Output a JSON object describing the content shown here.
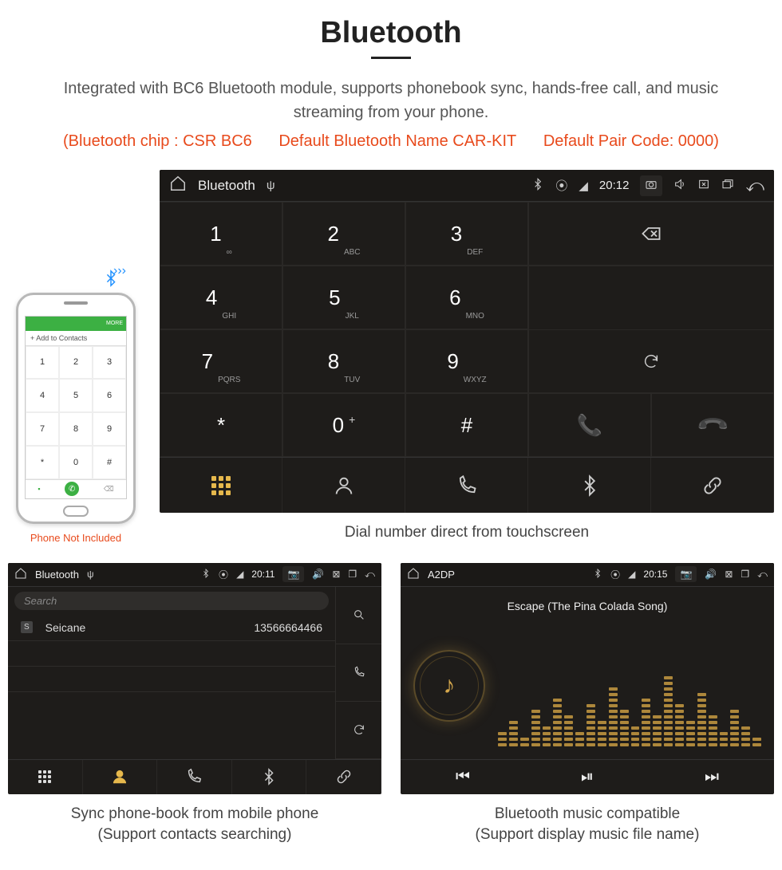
{
  "header": {
    "title": "Bluetooth",
    "subtitle": "Integrated with BC6 Bluetooth module, supports phonebook sync, hands-free call, and music streaming from your phone.",
    "red_chip": "(Bluetooth chip : CSR BC6",
    "red_name": "Default Bluetooth Name CAR-KIT",
    "red_pair": "Default Pair Code: 0000)"
  },
  "phone_mock": {
    "add_contacts": "+  Add to Contacts",
    "more": "MORE",
    "keys": [
      "1",
      "2",
      "3",
      "4",
      "5",
      "6",
      "7",
      "8",
      "9",
      "*",
      "0",
      "#"
    ],
    "note": "Phone Not Included"
  },
  "main_panel": {
    "app": "Bluetooth",
    "time": "20:12",
    "keys": [
      {
        "n": "1",
        "s": "∞"
      },
      {
        "n": "2",
        "s": "ABC"
      },
      {
        "n": "3",
        "s": "DEF"
      },
      {
        "n": "4",
        "s": "GHI"
      },
      {
        "n": "5",
        "s": "JKL"
      },
      {
        "n": "6",
        "s": "MNO"
      },
      {
        "n": "7",
        "s": "PQRS"
      },
      {
        "n": "8",
        "s": "TUV"
      },
      {
        "n": "9",
        "s": "WXYZ"
      },
      {
        "n": "*",
        "s": ""
      },
      {
        "n": "0",
        "s": "+",
        "sup": true
      },
      {
        "n": "#",
        "s": ""
      }
    ],
    "caption": "Dial number direct from touchscreen"
  },
  "pb_panel": {
    "app": "Bluetooth",
    "time": "20:11",
    "search_placeholder": "Search",
    "contact_name": "Seicane",
    "contact_number": "13566664466",
    "contact_tag": "S",
    "caption_l1": "Sync phone-book from mobile phone",
    "caption_l2": "(Support contacts searching)"
  },
  "a2_panel": {
    "app": "A2DP",
    "time": "20:15",
    "song": "Escape (The Pina Colada Song)",
    "caption_l1": "Bluetooth music compatible",
    "caption_l2": "(Support display music file name)"
  }
}
